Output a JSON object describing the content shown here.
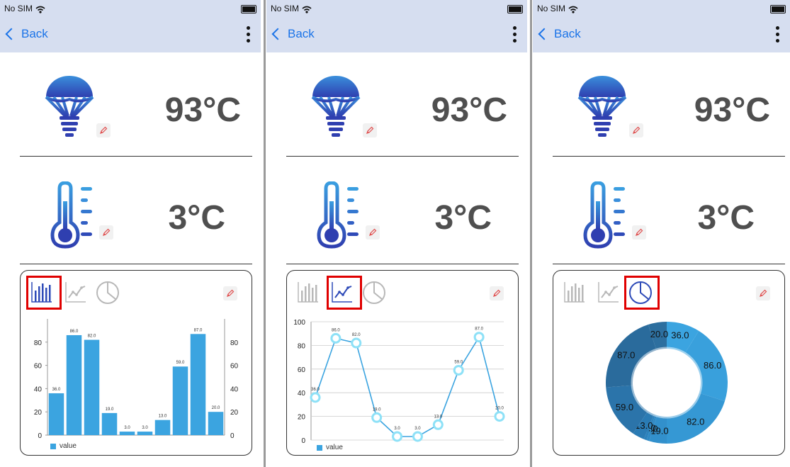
{
  "status": {
    "carrier": "No SIM"
  },
  "nav": {
    "back_label": "Back"
  },
  "widgets": {
    "bulb": {
      "value": "93°C",
      "icon": "lightbulb-icon"
    },
    "thermometer": {
      "value": "3°C",
      "icon": "thermometer-icon"
    }
  },
  "colors": {
    "accent": "#2e4bb8",
    "nav_bg": "#d6def0",
    "back": "#1a73e8",
    "bar": "#3ba4e0",
    "line": "#3ba4e0",
    "marker": "#8ee1f7",
    "selected_border": "#e00000"
  },
  "screens": [
    {
      "selected_tab": "bar"
    },
    {
      "selected_tab": "line"
    },
    {
      "selected_tab": "pie"
    }
  ],
  "chart_data": [
    {
      "type": "bar",
      "values": [
        36.0,
        86.0,
        82.0,
        19.0,
        3.0,
        3.0,
        13.0,
        59.0,
        87.0,
        20.0
      ],
      "value_labels": [
        "36.0",
        "86.0",
        "82.0",
        "19.0",
        "3.0",
        "3.0",
        "13.0",
        "59.0",
        "87.0",
        "20.0"
      ],
      "ylim": [
        0,
        100
      ],
      "yticks": [
        "0",
        "20",
        "40",
        "60",
        "80"
      ],
      "legend": "value"
    },
    {
      "type": "line",
      "values": [
        36.0,
        86.0,
        82.0,
        19.0,
        3.0,
        3.0,
        13.0,
        59.0,
        87.0,
        20.0
      ],
      "value_labels": [
        "36.0",
        "86.0",
        "82.0",
        "19.0",
        "3.0",
        "3.0",
        "13.0",
        "59.0",
        "87.0",
        "20.0"
      ],
      "ylim": [
        0,
        100
      ],
      "yticks": [
        "0",
        "20",
        "40",
        "60",
        "80",
        "100"
      ],
      "legend": "value"
    },
    {
      "type": "pie",
      "values": [
        36.0,
        86.0,
        82.0,
        19.0,
        3.0,
        3.0,
        13.0,
        59.0,
        87.0,
        20.0
      ],
      "slice_labels": [
        "36.0",
        "86.0",
        "82.0",
        "19.0",
        "3.0",
        "3.0",
        "13.0",
        "59.0",
        "87.0",
        "20.0"
      ],
      "donut": true
    }
  ]
}
